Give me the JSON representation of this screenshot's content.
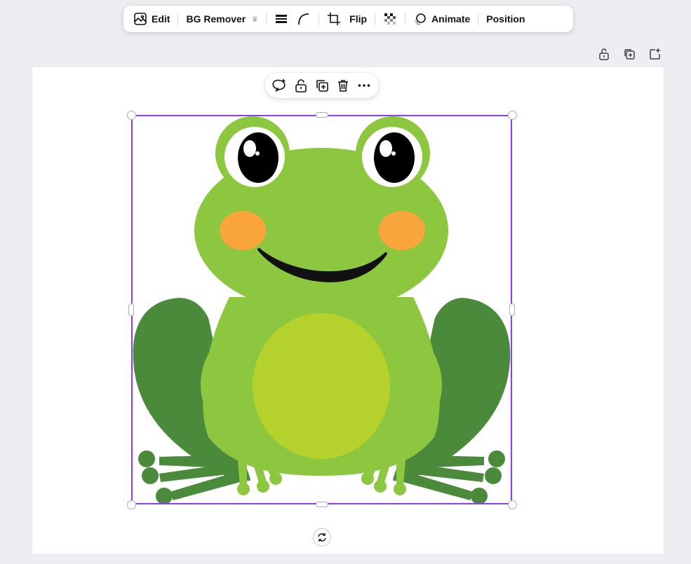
{
  "toolbar": {
    "edit_label": "Edit",
    "bg_remover_label": "BG Remover",
    "flip_label": "Flip",
    "animate_label": "Animate",
    "position_label": "Position"
  },
  "page_tools": [
    "lock-icon",
    "duplicate-icon",
    "add-page-icon"
  ],
  "context_menu": [
    "comment-icon",
    "lock-icon",
    "duplicate-icon",
    "trash-icon",
    "more-icon"
  ],
  "image": {
    "subject": "frog",
    "colors": {
      "body": "#8dc63f",
      "legs": "#4a8a3a",
      "belly": "#b5d12b",
      "cheeks": "#f9a53c",
      "eyes": "#000000",
      "selection": "#8b3dff"
    }
  }
}
